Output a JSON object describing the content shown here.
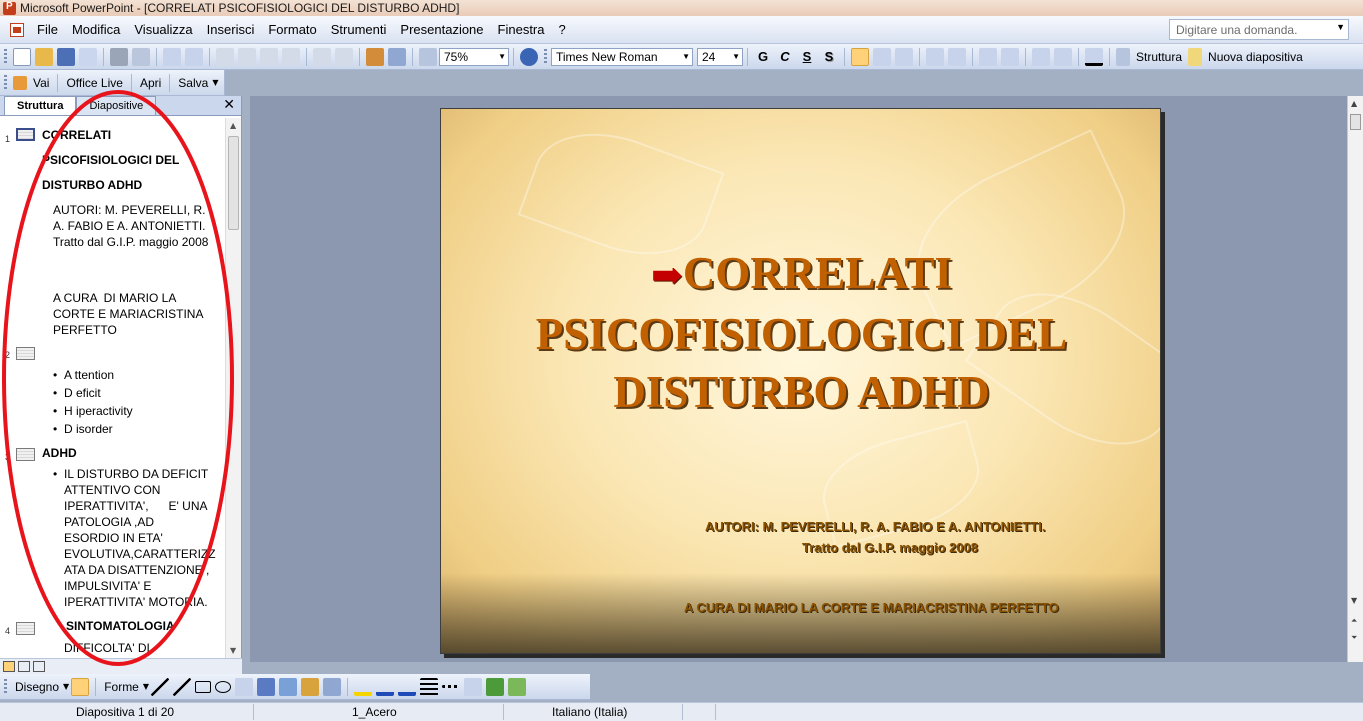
{
  "window": {
    "title": "Microsoft PowerPoint - [CORRELATI PSICOFISIOLOGICI DEL DISTURBO ADHD]"
  },
  "menu": {
    "items": [
      "File",
      "Modifica",
      "Visualizza",
      "Inserisci",
      "Formato",
      "Strumenti",
      "Presentazione",
      "Finestra",
      "?"
    ],
    "help_placeholder": "Digitare una domanda."
  },
  "toolbar": {
    "zoom": "75%",
    "font_name": "Times New Roman",
    "font_size": "24",
    "bold": "G",
    "italic": "C",
    "underline": "S",
    "shadow": "S",
    "outline_btn": "Struttura",
    "new_slide_btn": "Nuova diapositiva"
  },
  "web_toolbar": {
    "go": "Vai",
    "office_live": "Office Live",
    "open": "Apri",
    "save": "Salva"
  },
  "left_pane": {
    "tabs": [
      "Struttura",
      "Diapositive"
    ],
    "active_tab": "Struttura",
    "slides": [
      {
        "number": "1",
        "title_lines": [
          "CORRELATI",
          "PSICOFISIOLOGICI DEL",
          "DISTURBO ADHD"
        ],
        "text1": "AUTORI: M. PEVERELLI, R.\nA. FABIO E A. ANTONIETTI.\nTratto dal G.I.P. maggio 2008",
        "text2": "A CURA  DI MARIO LA\nCORTE E MARIACRISTINA\nPERFETTO"
      },
      {
        "number": "2",
        "bullets": [
          "A ttention",
          "D eficit",
          "H iperactivity",
          "D isorder"
        ]
      },
      {
        "number": "3",
        "title": "ADHD",
        "bullet": "IL DISTURBO DA DEFICIT\nATTENTIVO CON\nIPERATTIVITA',      E' UNA\nPATOLOGIA ,AD\nESORDIO IN ETA'\nEVOLUTIVA,CARATTERIZZ\nATA DA DISATTENZIONE ,\nIMPULSIVITA' E\nIPERATTIVITA' MOTORIA."
      },
      {
        "number": "4",
        "title": "SINTOMATOLOGIA",
        "text": "DIFFICOLTA' DI"
      }
    ]
  },
  "slide": {
    "title_lines": [
      "CORRELATI",
      "PSICOFISIOLOGICI DEL",
      "DISTURBO ADHD"
    ],
    "arrow": "➡",
    "authors_line1": "AUTORI: M. PEVERELLI, R. A. FABIO E A. ANTONIETTI.",
    "authors_line2": "Tratto dal G.I.P. maggio 2008",
    "curator": "A CURA  DI MARIO LA CORTE E MARIACRISTINA PERFETTO"
  },
  "draw_toolbar": {
    "draw": "Disegno",
    "shapes": "Forme"
  },
  "status": {
    "slide_pos": "Diapositiva 1 di 20",
    "design": "1_Acero",
    "language": "Italiano (Italia)"
  },
  "colors": {
    "accent_annotation": "#e8141c",
    "title_color": "#c06000"
  }
}
